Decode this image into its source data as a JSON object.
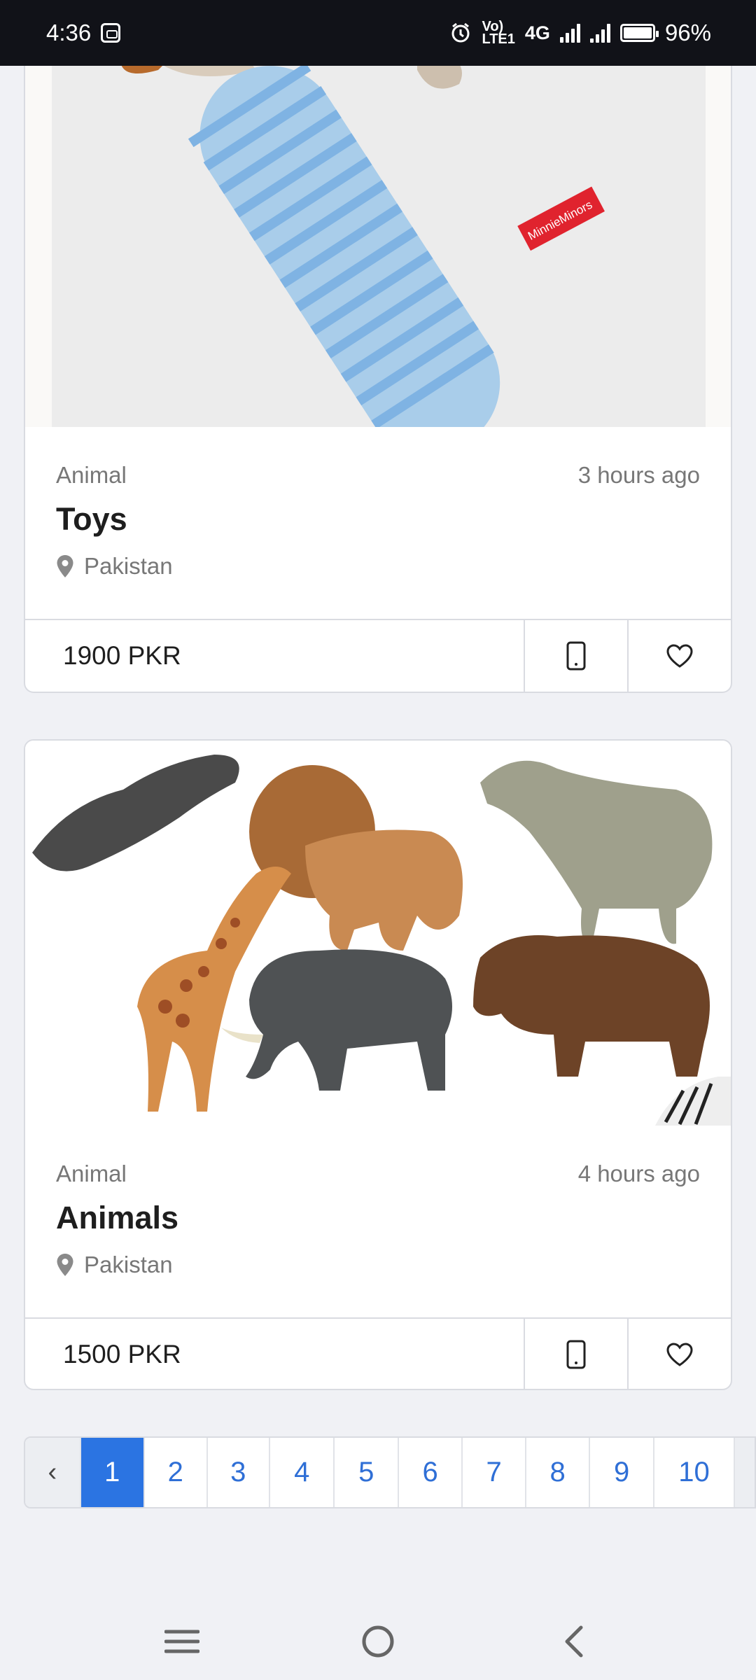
{
  "status_bar": {
    "time": "4:36",
    "net_volte": "Vo)",
    "net_lte": "LTE1",
    "net_type": "4G",
    "battery": "96%"
  },
  "listings": [
    {
      "category": "Animal",
      "time_ago": "3 hours ago",
      "title": "Toys",
      "location": "Pakistan",
      "price": "1900 PKR",
      "image_label": "MinnieMinors"
    },
    {
      "category": "Animal",
      "time_ago": "4 hours ago",
      "title": "Animals",
      "location": "Pakistan",
      "price": "1500 PKR"
    }
  ],
  "pagination": {
    "prev": "‹",
    "pages": [
      "1",
      "2",
      "3",
      "4",
      "5",
      "6",
      "7",
      "8",
      "9",
      "10"
    ],
    "active": "1"
  },
  "icons": {
    "call": "phone-icon",
    "favorite": "heart-icon",
    "location": "location-pin-icon"
  },
  "colors": {
    "accent": "#2b74e2",
    "page_bg": "#f0f1f5"
  }
}
